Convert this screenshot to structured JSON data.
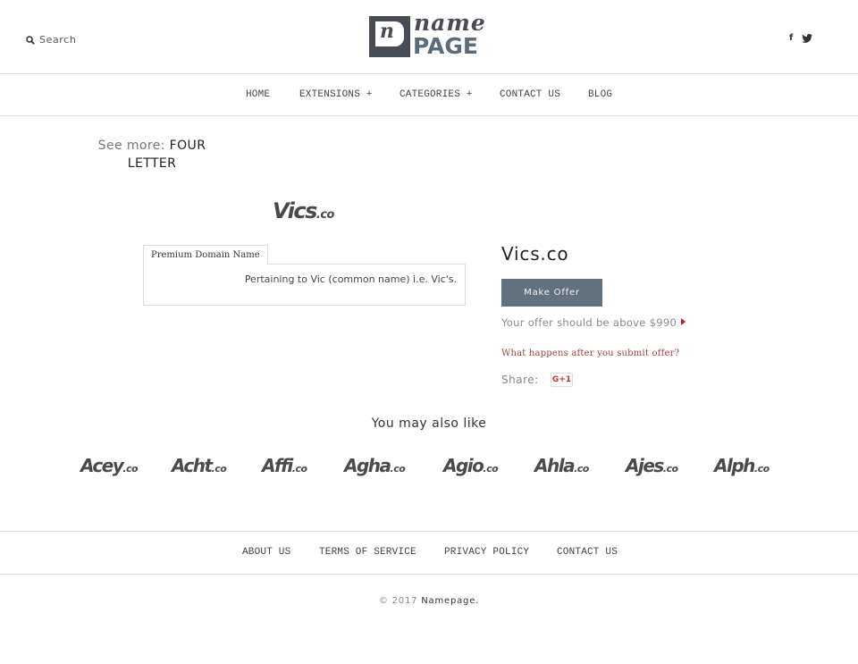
{
  "header": {
    "search_label": "Search",
    "logo_mark": "n",
    "logo_name": "name",
    "logo_page": "PAGE",
    "social": {
      "facebook": "f"
    }
  },
  "nav": {
    "items": [
      {
        "label": "HOME"
      },
      {
        "label": "EXTENSIONS +"
      },
      {
        "label": "CATEGORIES +"
      },
      {
        "label": "CONTACT US"
      },
      {
        "label": "BLOG"
      }
    ]
  },
  "see_more": {
    "label": "See more:",
    "value": "FOUR LETTER"
  },
  "domain": {
    "logo_name": "Vics",
    "logo_tld": ".co",
    "tab_label": "Premium Domain Name",
    "description": "Pertaining to Vic (common name) i.e. Vic's.",
    "title": "Vics.co",
    "make_offer_label": "Make Offer",
    "offer_hint": "Your offer should be above $990",
    "what_happens_link": "What happens after you submit offer?",
    "share_label": "Share:",
    "gplus_label": "G+1"
  },
  "colors": {
    "button": "#627180",
    "link_red": "#a0403f",
    "logo_dark": "#474c55",
    "logo_blue": "#5b6b7a"
  },
  "related": {
    "heading": "You may also like",
    "items": [
      {
        "name": "Acey",
        "tld": ".co"
      },
      {
        "name": "Acht",
        "tld": ".co"
      },
      {
        "name": "Affi",
        "tld": ".co"
      },
      {
        "name": "Agha",
        "tld": ".co"
      },
      {
        "name": "Agio",
        "tld": ".co"
      },
      {
        "name": "Ahla",
        "tld": ".co"
      },
      {
        "name": "Ajes",
        "tld": ".co"
      },
      {
        "name": "Alph",
        "tld": ".co"
      }
    ]
  },
  "footer": {
    "links": [
      {
        "label": "ABOUT US"
      },
      {
        "label": "TERMS OF SERVICE"
      },
      {
        "label": "PRIVACY POLICY"
      },
      {
        "label": "CONTACT US"
      }
    ],
    "copyright_prefix": "© 2017",
    "copyright_brand": "Namepage."
  }
}
